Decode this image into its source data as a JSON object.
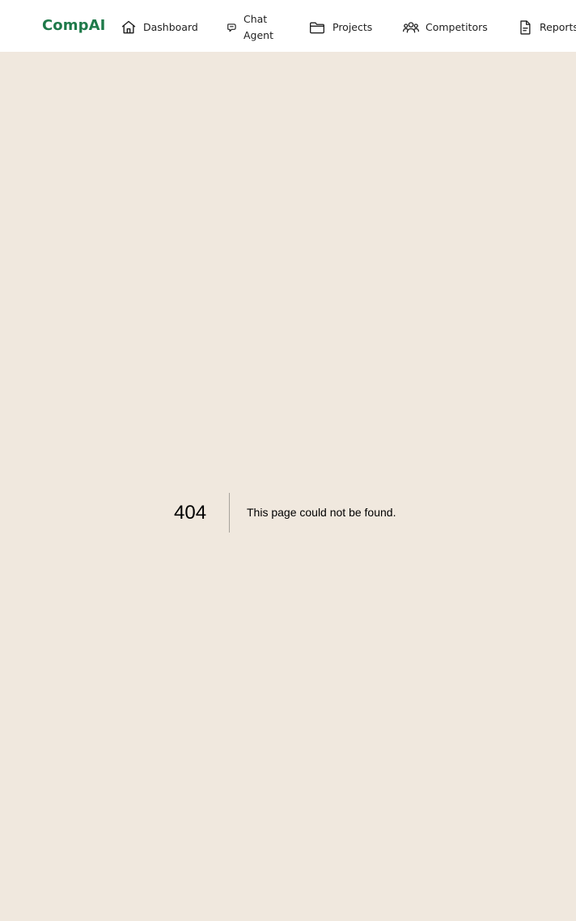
{
  "app": {
    "brand": "CompAI"
  },
  "nav": {
    "items": [
      {
        "label": "Dashboard",
        "icon": "home-icon"
      },
      {
        "label": "Chat Agent",
        "icon": "chat-icon"
      },
      {
        "label": "Projects",
        "icon": "folder-icon"
      },
      {
        "label": "Competitors",
        "icon": "users-icon"
      },
      {
        "label": "Reports",
        "icon": "document-icon"
      }
    ]
  },
  "error": {
    "code": "404",
    "message": "This page could not be found."
  },
  "colors": {
    "brand": "#1f7a4a",
    "page_background": "#f0e8de",
    "topbar_background": "#ffffff"
  }
}
